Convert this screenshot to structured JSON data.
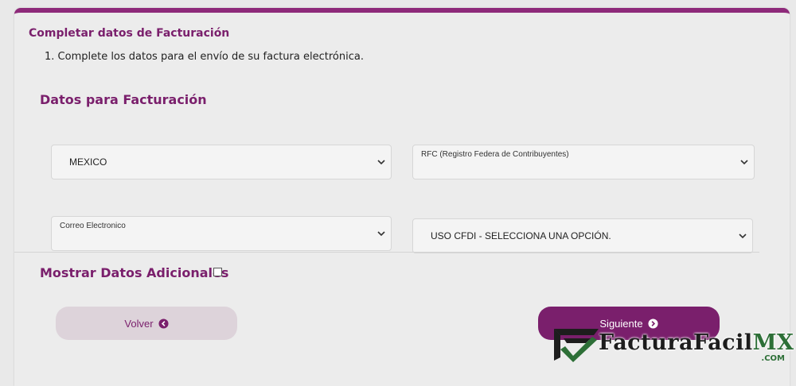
{
  "header": {
    "section_title": "Completar datos de Facturación",
    "instruction": "1. Complete los datos para el envío de su factura electrónica."
  },
  "form": {
    "title": "Datos para Facturación",
    "country": {
      "value": "MEXICO"
    },
    "rfc": {
      "label": "RFC (Registro Federa de Contribuyentes)",
      "value": ""
    },
    "email": {
      "label": "Correo Electronico",
      "value": ""
    },
    "uso_cfdi": {
      "value": "USO CFDI - SELECCIONA UNA OPCIÓN."
    }
  },
  "extra": {
    "label": "Mostrar Datos Adicionales",
    "checked": false
  },
  "buttons": {
    "back_label": "Volver",
    "next_label": "Siguiente"
  },
  "brand": {
    "name_main": "FacturaFacil",
    "name_suffix": "MX",
    "domain": ".COM",
    "colors": {
      "primary": "#7a1f6c",
      "brand_green": "#2d6f37"
    }
  }
}
